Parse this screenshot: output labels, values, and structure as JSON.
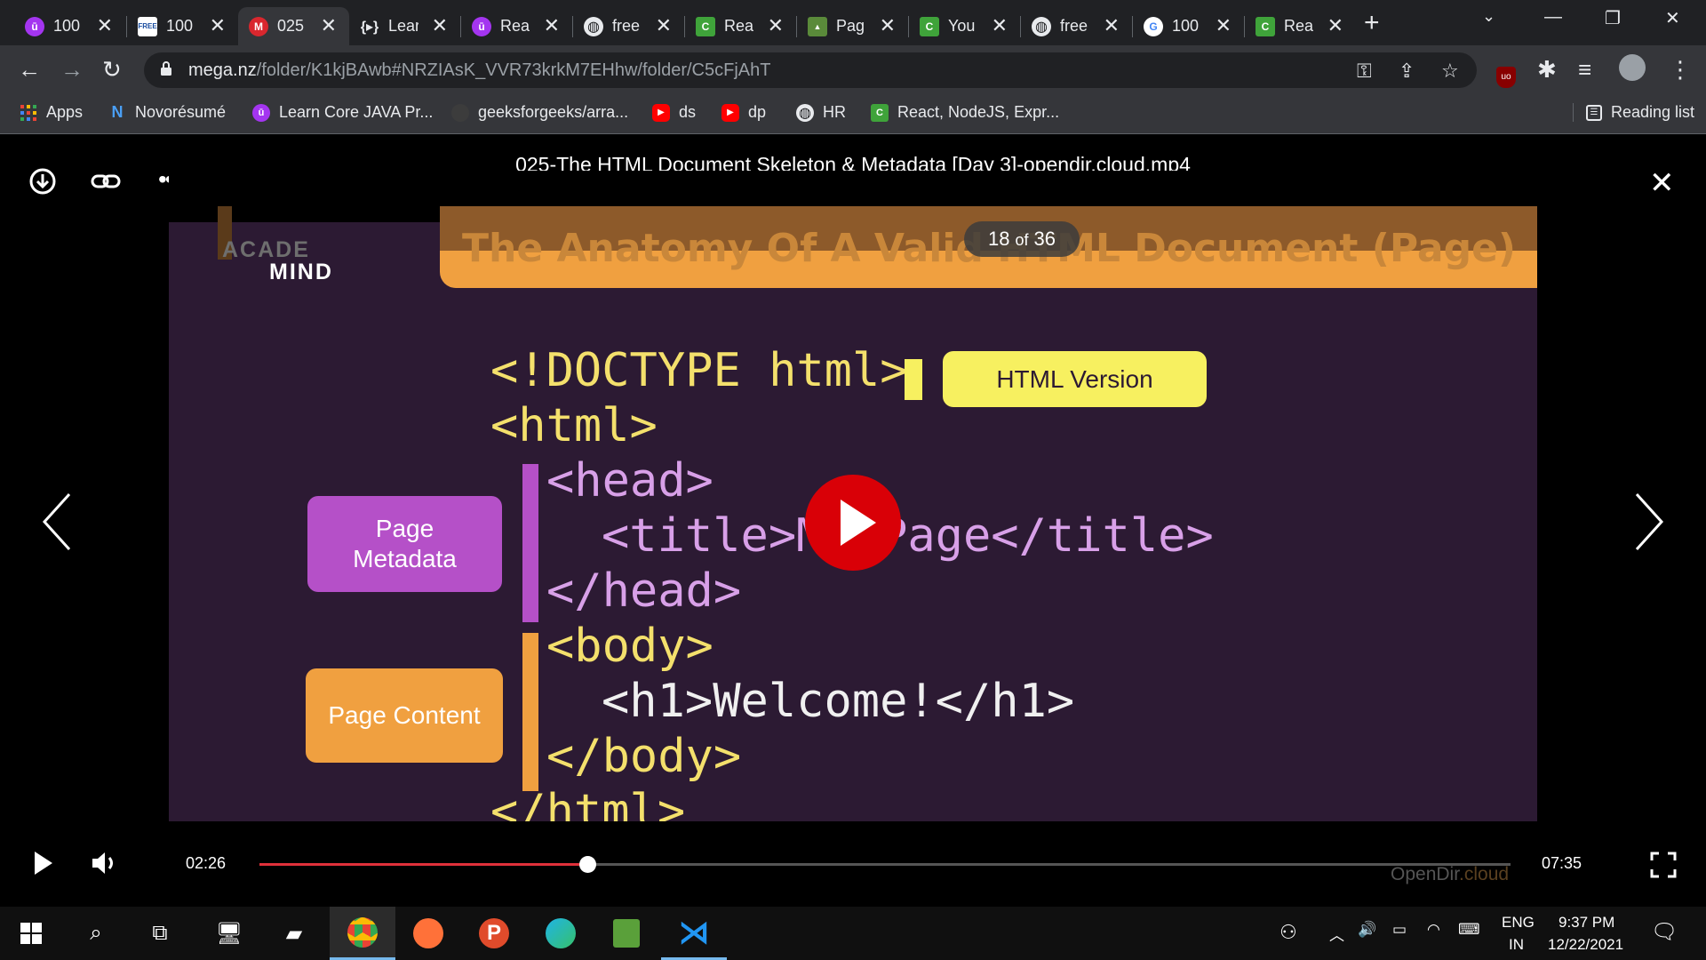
{
  "tabs": [
    {
      "title": "100",
      "icon": "udemy-icon",
      "color": "#a435f0"
    },
    {
      "title": "100",
      "icon": "free-icon",
      "color": "#ffffff"
    },
    {
      "title": "025",
      "icon": "mega-icon",
      "color": "#d9272e",
      "active": true
    },
    {
      "title": "Lear",
      "icon": "code-icon",
      "color": "#35363a"
    },
    {
      "title": "Rea",
      "icon": "udemy-icon",
      "color": "#a435f0"
    },
    {
      "title": "free",
      "icon": "globe-icon",
      "color": "#e8eaed"
    },
    {
      "title": "Rea",
      "icon": "freecodecamp-icon",
      "color": "#3fa33a"
    },
    {
      "title": "Pag",
      "icon": "page-icon",
      "color": "#5a8a3a"
    },
    {
      "title": "You",
      "icon": "freecodecamp-icon",
      "color": "#3fa33a"
    },
    {
      "title": "free",
      "icon": "globe-icon",
      "color": "#e8eaed"
    },
    {
      "title": "100",
      "icon": "google-icon",
      "color": "#ffffff"
    },
    {
      "title": "Rea",
      "icon": "freecodecamp-icon",
      "color": "#3fa33a"
    }
  ],
  "address": {
    "host": "mega.nz",
    "path": "/folder/K1kjBAwb#NRZIAsK_VVR73krkM7EHhw/folder/C5cFjAhT"
  },
  "bookmarks": [
    {
      "label": "Apps",
      "icon": "apps-grid-icon"
    },
    {
      "label": "Novorésumé",
      "icon": "novoresume-icon"
    },
    {
      "label": "Learn Core JAVA Pr...",
      "icon": "udemy-icon"
    },
    {
      "label": "geeksforgeeks/arra...",
      "icon": "github-icon"
    },
    {
      "label": "ds",
      "icon": "youtube-icon"
    },
    {
      "label": "dp",
      "icon": "youtube-icon"
    },
    {
      "label": "HR",
      "icon": "globe-icon"
    },
    {
      "label": "React, NodeJS, Expr...",
      "icon": "freecodecamp-icon"
    }
  ],
  "reading_list": "Reading list",
  "viewer": {
    "file_title": "025-The HTML Document Skeleton & Metadata [Day 3]-opendir.cloud.mp4",
    "page_current": "18",
    "page_of": "of",
    "page_total": "36",
    "time_current": "02:26",
    "time_total": "07:35",
    "progress": 0.262,
    "watermark_a": "OpenDir",
    "watermark_b": ".cloud"
  },
  "slide": {
    "banner_title": "The Anatomy Of A Valid HTML Document (Page)",
    "logo_top": "ACADE",
    "logo_bottom": "MIND",
    "code_lines": [
      "<!DOCTYPE html>",
      "<html>",
      "<head>",
      "<title>My Page</title>",
      "</head>",
      "<body>",
      "<h1>Welcome!</h1>",
      "</body>",
      "</html>"
    ],
    "callout_version": "HTML Version",
    "callout_metadata": "Page Metadata",
    "callout_content": "Page Content"
  },
  "taskbar": {
    "lang_top": "ENG",
    "lang_bottom": "IN",
    "time": "9:37 PM",
    "date": "12/22/2021"
  },
  "colors": {
    "progress": "#e0303a",
    "play_button": "#d90007",
    "callout_yellow": "#f7f060",
    "callout_purple": "#b550c8",
    "callout_orange": "#f0a040"
  }
}
